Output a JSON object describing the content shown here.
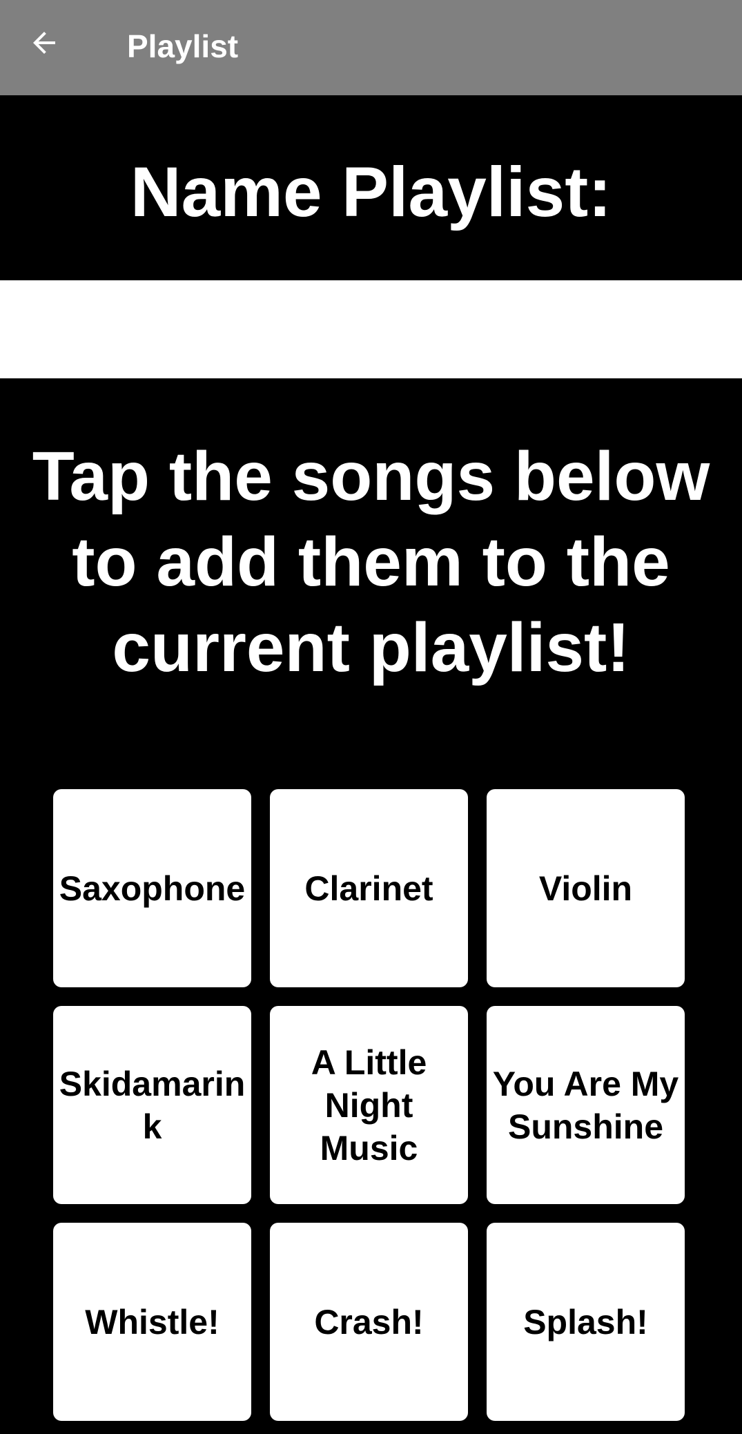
{
  "app_bar": {
    "title": "Playlist",
    "back_icon": "arrow-left-icon",
    "background": "#808080"
  },
  "name_section": {
    "label": "Name Playlist:",
    "input_value": "",
    "input_placeholder": ""
  },
  "instructions": "Tap the songs below to add them to the current playlist!",
  "songs": [
    {
      "label": "Saxophone"
    },
    {
      "label": "Clarinet"
    },
    {
      "label": "Violin"
    },
    {
      "label": "Skidamarink"
    },
    {
      "label": "A Little Night Music"
    },
    {
      "label": "You Are My Sunshine"
    },
    {
      "label": "Whistle!"
    },
    {
      "label": "Crash!"
    },
    {
      "label": "Splash!"
    }
  ]
}
